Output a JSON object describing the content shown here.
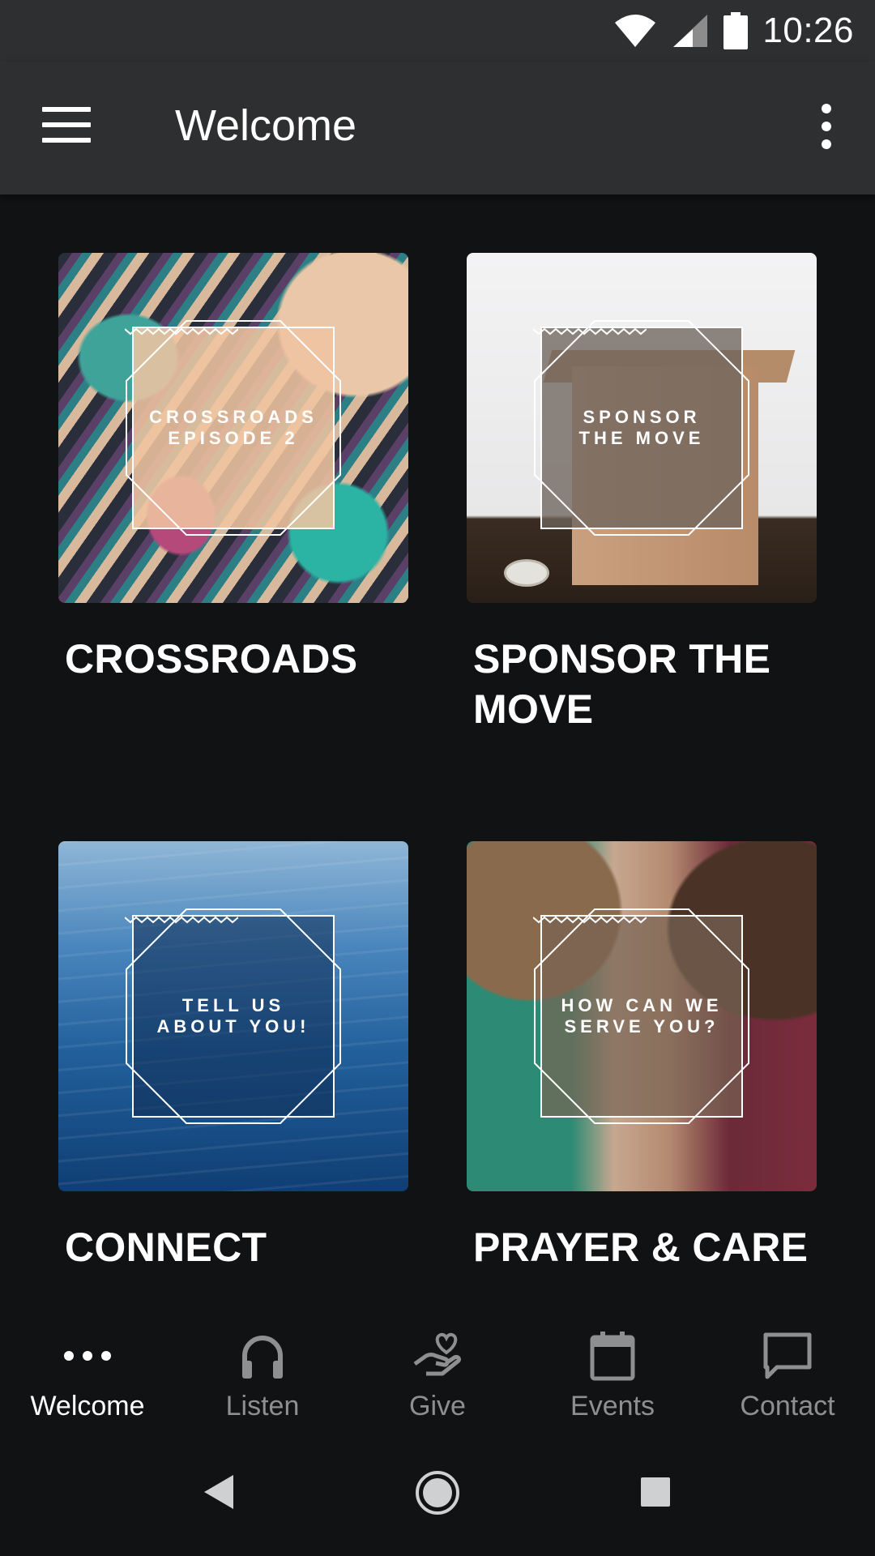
{
  "status_bar": {
    "time": "10:26",
    "icons": [
      "wifi-icon",
      "cell-signal-icon",
      "battery-icon"
    ]
  },
  "app_bar": {
    "title": "Welcome",
    "menu_icon": "hamburger-menu-icon",
    "overflow_icon": "more-vert-icon"
  },
  "cards": [
    {
      "title": "CROSSROADS",
      "overlay_line1": "CROSSROADS",
      "overlay_line2": "EPISODE 2"
    },
    {
      "title": "SPONSOR THE MOVE",
      "overlay_line1": "SPONSOR",
      "overlay_line2": "THE MOVE"
    },
    {
      "title": "CONNECT",
      "overlay_line1": "TELL US",
      "overlay_line2": "ABOUT YOU!"
    },
    {
      "title": "PRAYER & CARE",
      "overlay_line1": "HOW CAN WE",
      "overlay_line2": "SERVE YOU?"
    }
  ],
  "bottom_nav": {
    "items": [
      {
        "label": "Welcome",
        "icon": "more-horiz-icon",
        "active": true
      },
      {
        "label": "Listen",
        "icon": "headphones-icon",
        "active": false
      },
      {
        "label": "Give",
        "icon": "giving-hand-icon",
        "active": false
      },
      {
        "label": "Events",
        "icon": "calendar-icon",
        "active": false
      },
      {
        "label": "Contact",
        "icon": "chat-bubble-icon",
        "active": false
      }
    ]
  },
  "system_nav": {
    "icons": [
      "back-icon",
      "home-icon",
      "recents-icon"
    ]
  },
  "colors": {
    "background": "#111214",
    "app_bar": "#2e2f30",
    "text_primary": "#ffffff",
    "nav_inactive": "#8e8f91"
  }
}
